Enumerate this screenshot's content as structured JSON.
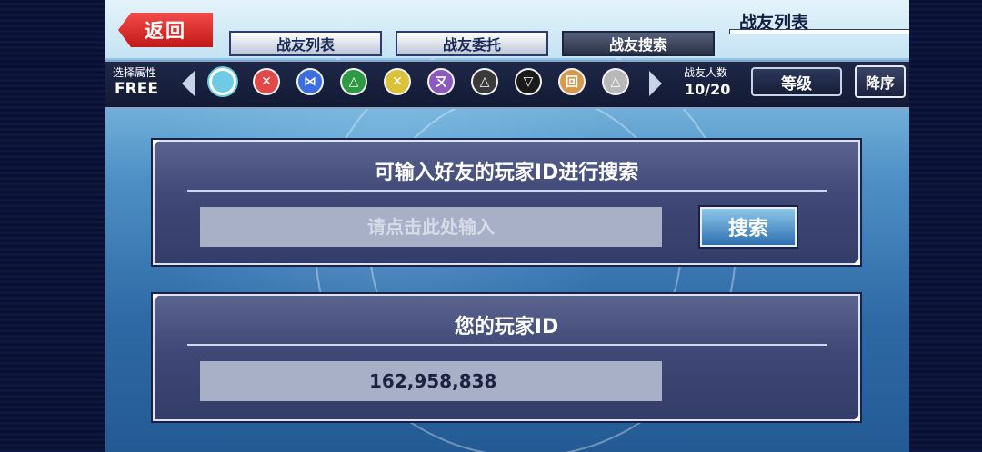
{
  "back_button": {
    "label": "返回"
  },
  "tabs": [
    {
      "label": "战友列表",
      "active": false
    },
    {
      "label": "战友委托",
      "active": false
    },
    {
      "label": "战友搜索",
      "active": true
    }
  ],
  "screen_title": "战友列表",
  "filter": {
    "attribute_label": "选择属性",
    "attribute_value": "FREE",
    "attribute_icons": [
      {
        "name": "attr-free-icon",
        "glyph": "",
        "color": "#6ecbe6"
      },
      {
        "name": "attr-fire-icon",
        "glyph": "✕",
        "color": "#e24848"
      },
      {
        "name": "attr-water-icon",
        "glyph": "⋈",
        "color": "#3b6ee0"
      },
      {
        "name": "attr-wood-icon",
        "glyph": "△",
        "color": "#2f9a44"
      },
      {
        "name": "attr-light-icon",
        "glyph": "✕",
        "color": "#d9c23a"
      },
      {
        "name": "attr-dark-icon",
        "glyph": "ㄡ",
        "color": "#8a5bbd"
      },
      {
        "name": "attr-void-icon",
        "glyph": "△",
        "color": "#3a3a3a"
      },
      {
        "name": "attr-shadow-icon",
        "glyph": "▽",
        "color": "#1b1b1b"
      },
      {
        "name": "attr-earth-icon",
        "glyph": "回",
        "color": "#d79a4b"
      },
      {
        "name": "attr-wind-icon",
        "glyph": "△",
        "color": "#b8b8b8"
      }
    ],
    "friend_count_label": "战友人数",
    "friend_count_value": "10/20",
    "sort_label": "等级",
    "order_label": "降序"
  },
  "search_panel": {
    "title": "可输入好友的玩家ID进行搜索",
    "input_placeholder": "请点击此处输入",
    "button_label": "搜索"
  },
  "id_panel": {
    "title": "您的玩家ID",
    "player_id": "162,958,838"
  }
}
